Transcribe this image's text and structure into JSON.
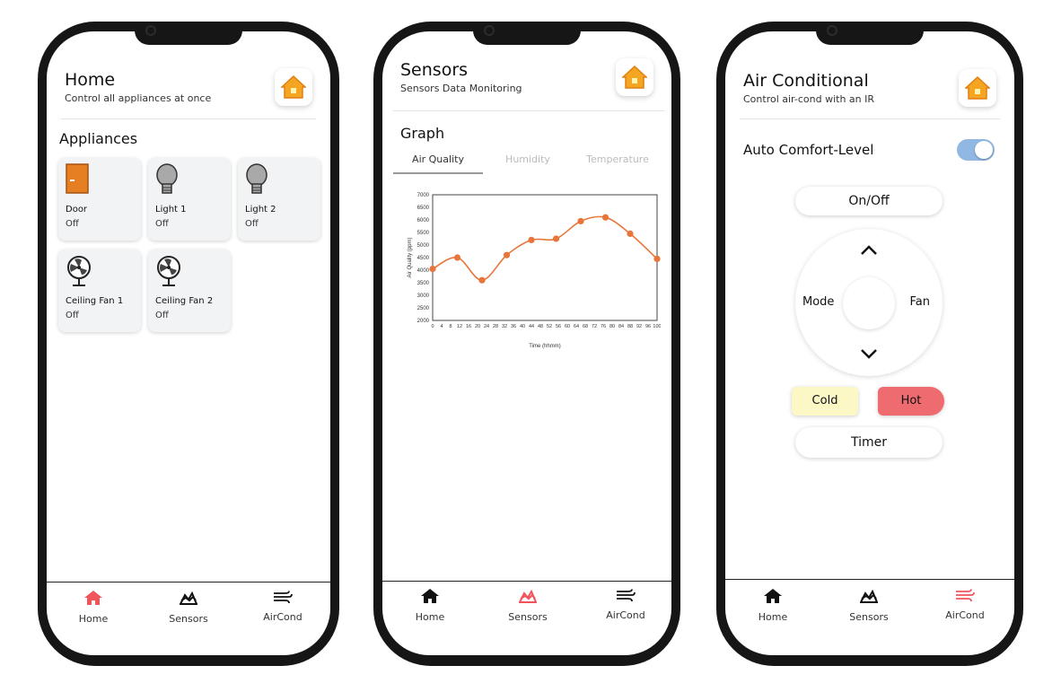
{
  "colors": {
    "accent": "#f2545b",
    "fan_orange": "#e8763a",
    "cold_bg": "#fbf8c6",
    "hot_bg": "#ee6b70",
    "toggle_on": "#90b8e3"
  },
  "home": {
    "title": "Home",
    "subtitle": "Control all appliances at once",
    "section": "Appliances",
    "appliances": [
      {
        "name": "Door",
        "status": "Off",
        "icon": "door-icon"
      },
      {
        "name": "Light 1",
        "status": "Off",
        "icon": "bulb-icon"
      },
      {
        "name": "Light 2",
        "status": "Off",
        "icon": "bulb-icon"
      },
      {
        "name": "Ceiling Fan 1",
        "status": "Off",
        "icon": "fan-icon"
      },
      {
        "name": "Ceiling Fan 2",
        "status": "Off",
        "icon": "fan-icon"
      }
    ]
  },
  "sensors": {
    "title": "Sensors",
    "subtitle": "Sensors Data Monitoring",
    "section": "Graph",
    "tabs": [
      "Air Quality",
      "Humidity",
      "Temperature"
    ],
    "active_tab": "Air Quality"
  },
  "aircond": {
    "title": "Air Conditional",
    "subtitle": "Control air-cond with an IR",
    "auto_label": "Auto Comfort-Level",
    "auto_on": true,
    "onoff_label": "On/Off",
    "mode_label": "Mode",
    "fan_label": "Fan",
    "cold_label": "Cold",
    "hot_label": "Hot",
    "timer_label": "Timer"
  },
  "nav": {
    "home": "Home",
    "sensors": "Sensors",
    "aircond": "AirCond"
  },
  "chart_data": {
    "type": "line",
    "title": "",
    "xlabel": "Time (hhmm)",
    "ylabel": "Air Quality (ppm)",
    "x_ticks": [
      0,
      4,
      8,
      12,
      16,
      20,
      24,
      28,
      32,
      36,
      40,
      44,
      48,
      52,
      56,
      60,
      64,
      68,
      72,
      76,
      80,
      84,
      88,
      92,
      96,
      100
    ],
    "y_ticks": [
      2000,
      2500,
      3000,
      3500,
      4000,
      4500,
      5000,
      5500,
      6000,
      6500,
      7000
    ],
    "xlim": [
      0,
      100
    ],
    "ylim": [
      2000,
      7000
    ],
    "series": [
      {
        "x": [
          0,
          11,
          22,
          33,
          44,
          55,
          66,
          77,
          88,
          100
        ],
        "values": [
          4050,
          4500,
          3600,
          4600,
          5200,
          5250,
          5950,
          6100,
          5450,
          4450
        ]
      }
    ]
  }
}
